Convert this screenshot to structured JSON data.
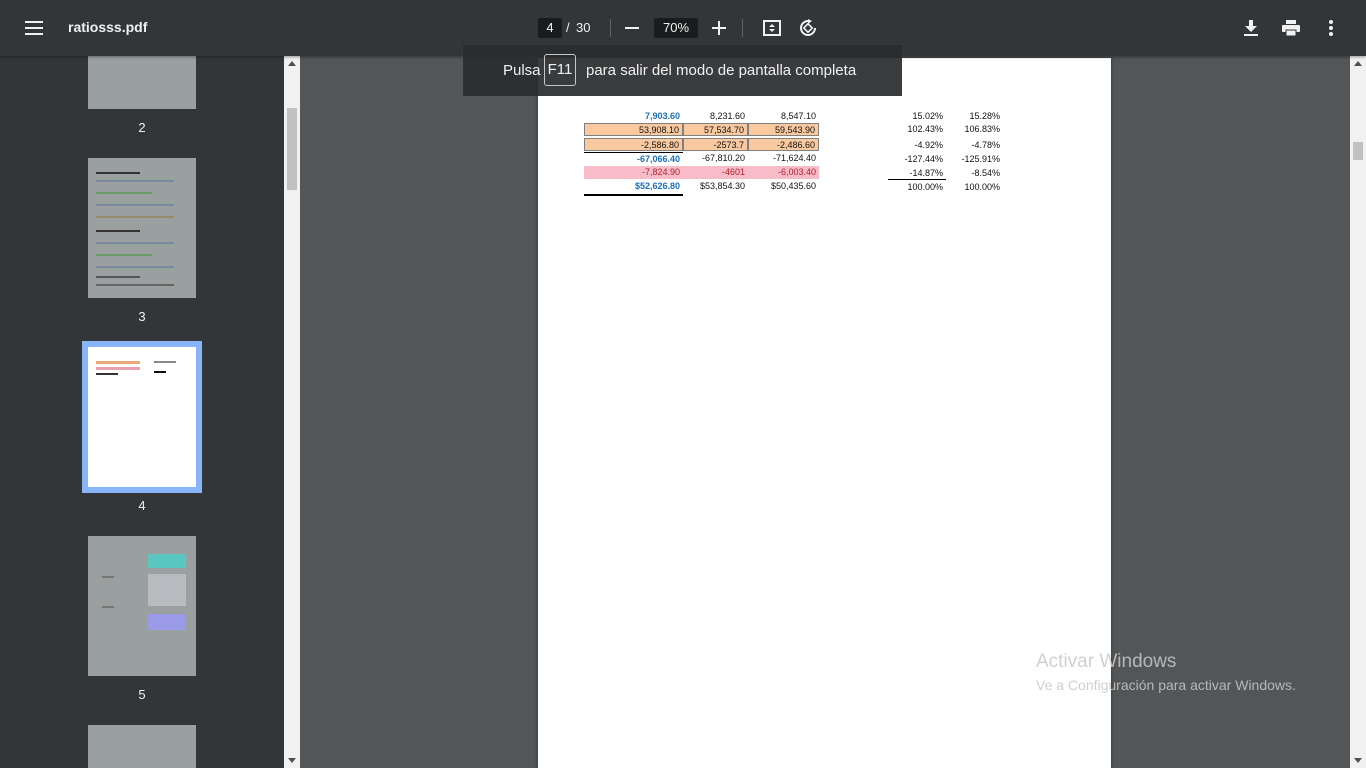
{
  "toolbar": {
    "file_name": "ratiosss.pdf",
    "current_page": "4",
    "page_separator": "/",
    "total_pages": "30",
    "zoom": "70%"
  },
  "toast": {
    "prefix": "Pulsa",
    "key": "F11",
    "suffix": "para salir del modo de pantalla completa"
  },
  "sidebar": {
    "thumbnails": [
      {
        "label": "2"
      },
      {
        "label": "3"
      },
      {
        "label": "4",
        "selected": true
      },
      {
        "label": "5"
      }
    ]
  },
  "page_content": {
    "rows": [
      {
        "c1": "7,903.60",
        "c2": "8,231.60",
        "c3": "8,547.10",
        "p1": "15.02%",
        "p2": "15.28%"
      },
      {
        "c1": "53,908.10",
        "c2": "57,534.70",
        "c3": "59,543.90",
        "p1": "102.43%",
        "p2": "106.83%"
      },
      {
        "c1": "-2,586.80",
        "c2": "-2573.7",
        "c3": "-2,486.60",
        "p1": "-4.92%",
        "p2": "-4.78%"
      },
      {
        "c1": "-67,066.40",
        "c2": "-67,810.20",
        "c3": "-71,624.40",
        "p1": "-127.44%",
        "p2": "-125.91%"
      },
      {
        "c1": "-7,824.90",
        "c2": "-4601",
        "c3": "-6,003.40",
        "p1": "-14.87%",
        "p2": "-8.54%"
      },
      {
        "c1": "$52,626.80",
        "c2": "$53,854.30",
        "c3": "$50,435.60",
        "p1": "100.00%",
        "p2": "100.00%"
      }
    ]
  },
  "watermark": {
    "line1": "Activar Windows",
    "line2": "Ve a Configuración para activar Windows."
  }
}
